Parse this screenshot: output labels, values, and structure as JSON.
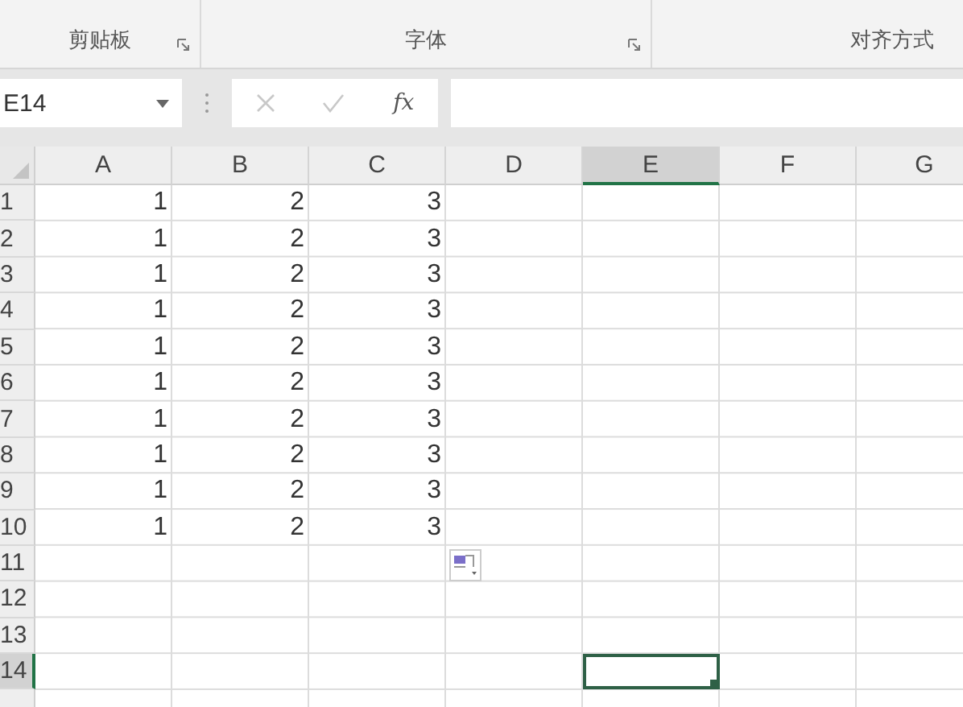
{
  "ribbon": {
    "groups": [
      {
        "label": "剪贴板",
        "launcher": true
      },
      {
        "label": "字体",
        "launcher": true
      },
      {
        "label": "对齐方式"
      }
    ]
  },
  "formula_bar": {
    "name_box": "E14",
    "function_label": "fx"
  },
  "columns": [
    {
      "label": "A",
      "selected": false
    },
    {
      "label": "B",
      "selected": false
    },
    {
      "label": "C",
      "selected": false
    },
    {
      "label": "D",
      "selected": false
    },
    {
      "label": "E",
      "selected": true
    },
    {
      "label": "F",
      "selected": false
    },
    {
      "label": "G",
      "selected": false
    }
  ],
  "rows": [
    {
      "label": "1",
      "selected": false,
      "cells": [
        "1",
        "2",
        "3"
      ]
    },
    {
      "label": "2",
      "selected": false,
      "cells": [
        "1",
        "2",
        "3"
      ]
    },
    {
      "label": "3",
      "selected": false,
      "cells": [
        "1",
        "2",
        "3"
      ]
    },
    {
      "label": "4",
      "selected": false,
      "cells": [
        "1",
        "2",
        "3"
      ]
    },
    {
      "label": "5",
      "selected": false,
      "cells": [
        "1",
        "2",
        "3"
      ]
    },
    {
      "label": "6",
      "selected": false,
      "cells": [
        "1",
        "2",
        "3"
      ]
    },
    {
      "label": "7",
      "selected": false,
      "cells": [
        "1",
        "2",
        "3"
      ]
    },
    {
      "label": "8",
      "selected": false,
      "cells": [
        "1",
        "2",
        "3"
      ]
    },
    {
      "label": "9",
      "selected": false,
      "cells": [
        "1",
        "2",
        "3"
      ]
    },
    {
      "label": "10",
      "selected": false,
      "cells": [
        "1",
        "2",
        "3"
      ]
    },
    {
      "label": "11",
      "selected": false,
      "cells": []
    },
    {
      "label": "12",
      "selected": false,
      "cells": []
    },
    {
      "label": "13",
      "selected": false,
      "cells": []
    },
    {
      "label": "14",
      "selected": true,
      "cells": []
    }
  ],
  "paste_options_visible": true
}
